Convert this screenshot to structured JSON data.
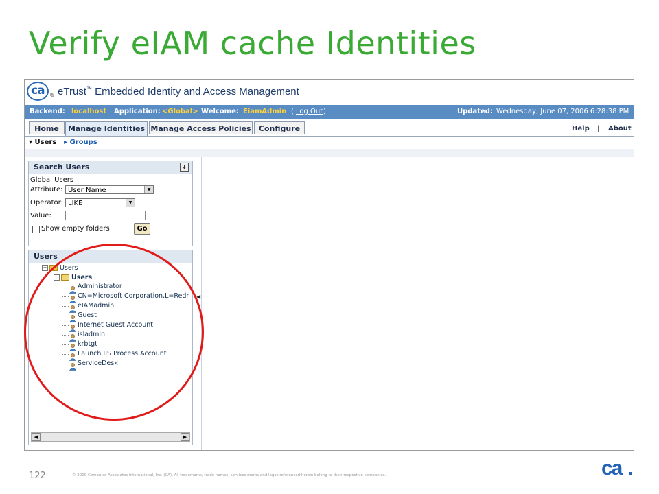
{
  "slide": {
    "title": "Verify eIAM cache Identities",
    "number": "122",
    "copyright": "© 2009 Computer Associates International, Inc. (CA). All trademarks, trade names, services marks and logos referenced herein belong to their respective companies."
  },
  "app": {
    "logo_text": "ca",
    "title": "eTrust",
    "title_tm": "™",
    "title_rest": " Embedded Identity and Access Management"
  },
  "status": {
    "backend_label": "Backend:",
    "backend_value": "localhost",
    "application_label": "Application:",
    "application_value": "<Global>",
    "welcome_label": "Welcome:",
    "welcome_value": "EiamAdmin",
    "logout_open": "(",
    "logout": "Log Out",
    "logout_close": ")",
    "updated_label": "Updated:",
    "updated_value": "Wednesday, June 07, 2006 6:28:38 PM"
  },
  "tabs": [
    {
      "label": "Home"
    },
    {
      "label": "Manage Identities"
    },
    {
      "label": "Manage Access Policies"
    },
    {
      "label": "Configure"
    }
  ],
  "topnav": {
    "help": "Help",
    "sep": "|",
    "about": "About"
  },
  "subnav": {
    "users": "▾ Users",
    "groups": "▸ Groups"
  },
  "search": {
    "title": "Search Users",
    "scope": "Global Users",
    "attribute_label": "Attribute:",
    "attribute_value": "User Name",
    "operator_label": "Operator:",
    "operator_value": "LIKE",
    "value_label": "Value:",
    "value": "",
    "show_empty_label": "Show empty folders",
    "go": "Go"
  },
  "users_panel": {
    "title": "Users",
    "root": "Users",
    "child": "Users",
    "items": [
      "Administrator",
      "CN=Microsoft Corporation,L=Redr",
      "eIAMadmin",
      "Guest",
      "Internet Guest Account",
      "isladmin",
      "krbtgt",
      "Launch IIS Process Account",
      "ServiceDesk"
    ]
  },
  "footer": {
    "logo": "ca"
  },
  "colors": {
    "title_green": "#3aaa35",
    "status_bar": "#5a8cc4",
    "highlight": "#ffd23a",
    "annotation_red": "#e11a1a",
    "brand_blue": "#2563b8"
  }
}
